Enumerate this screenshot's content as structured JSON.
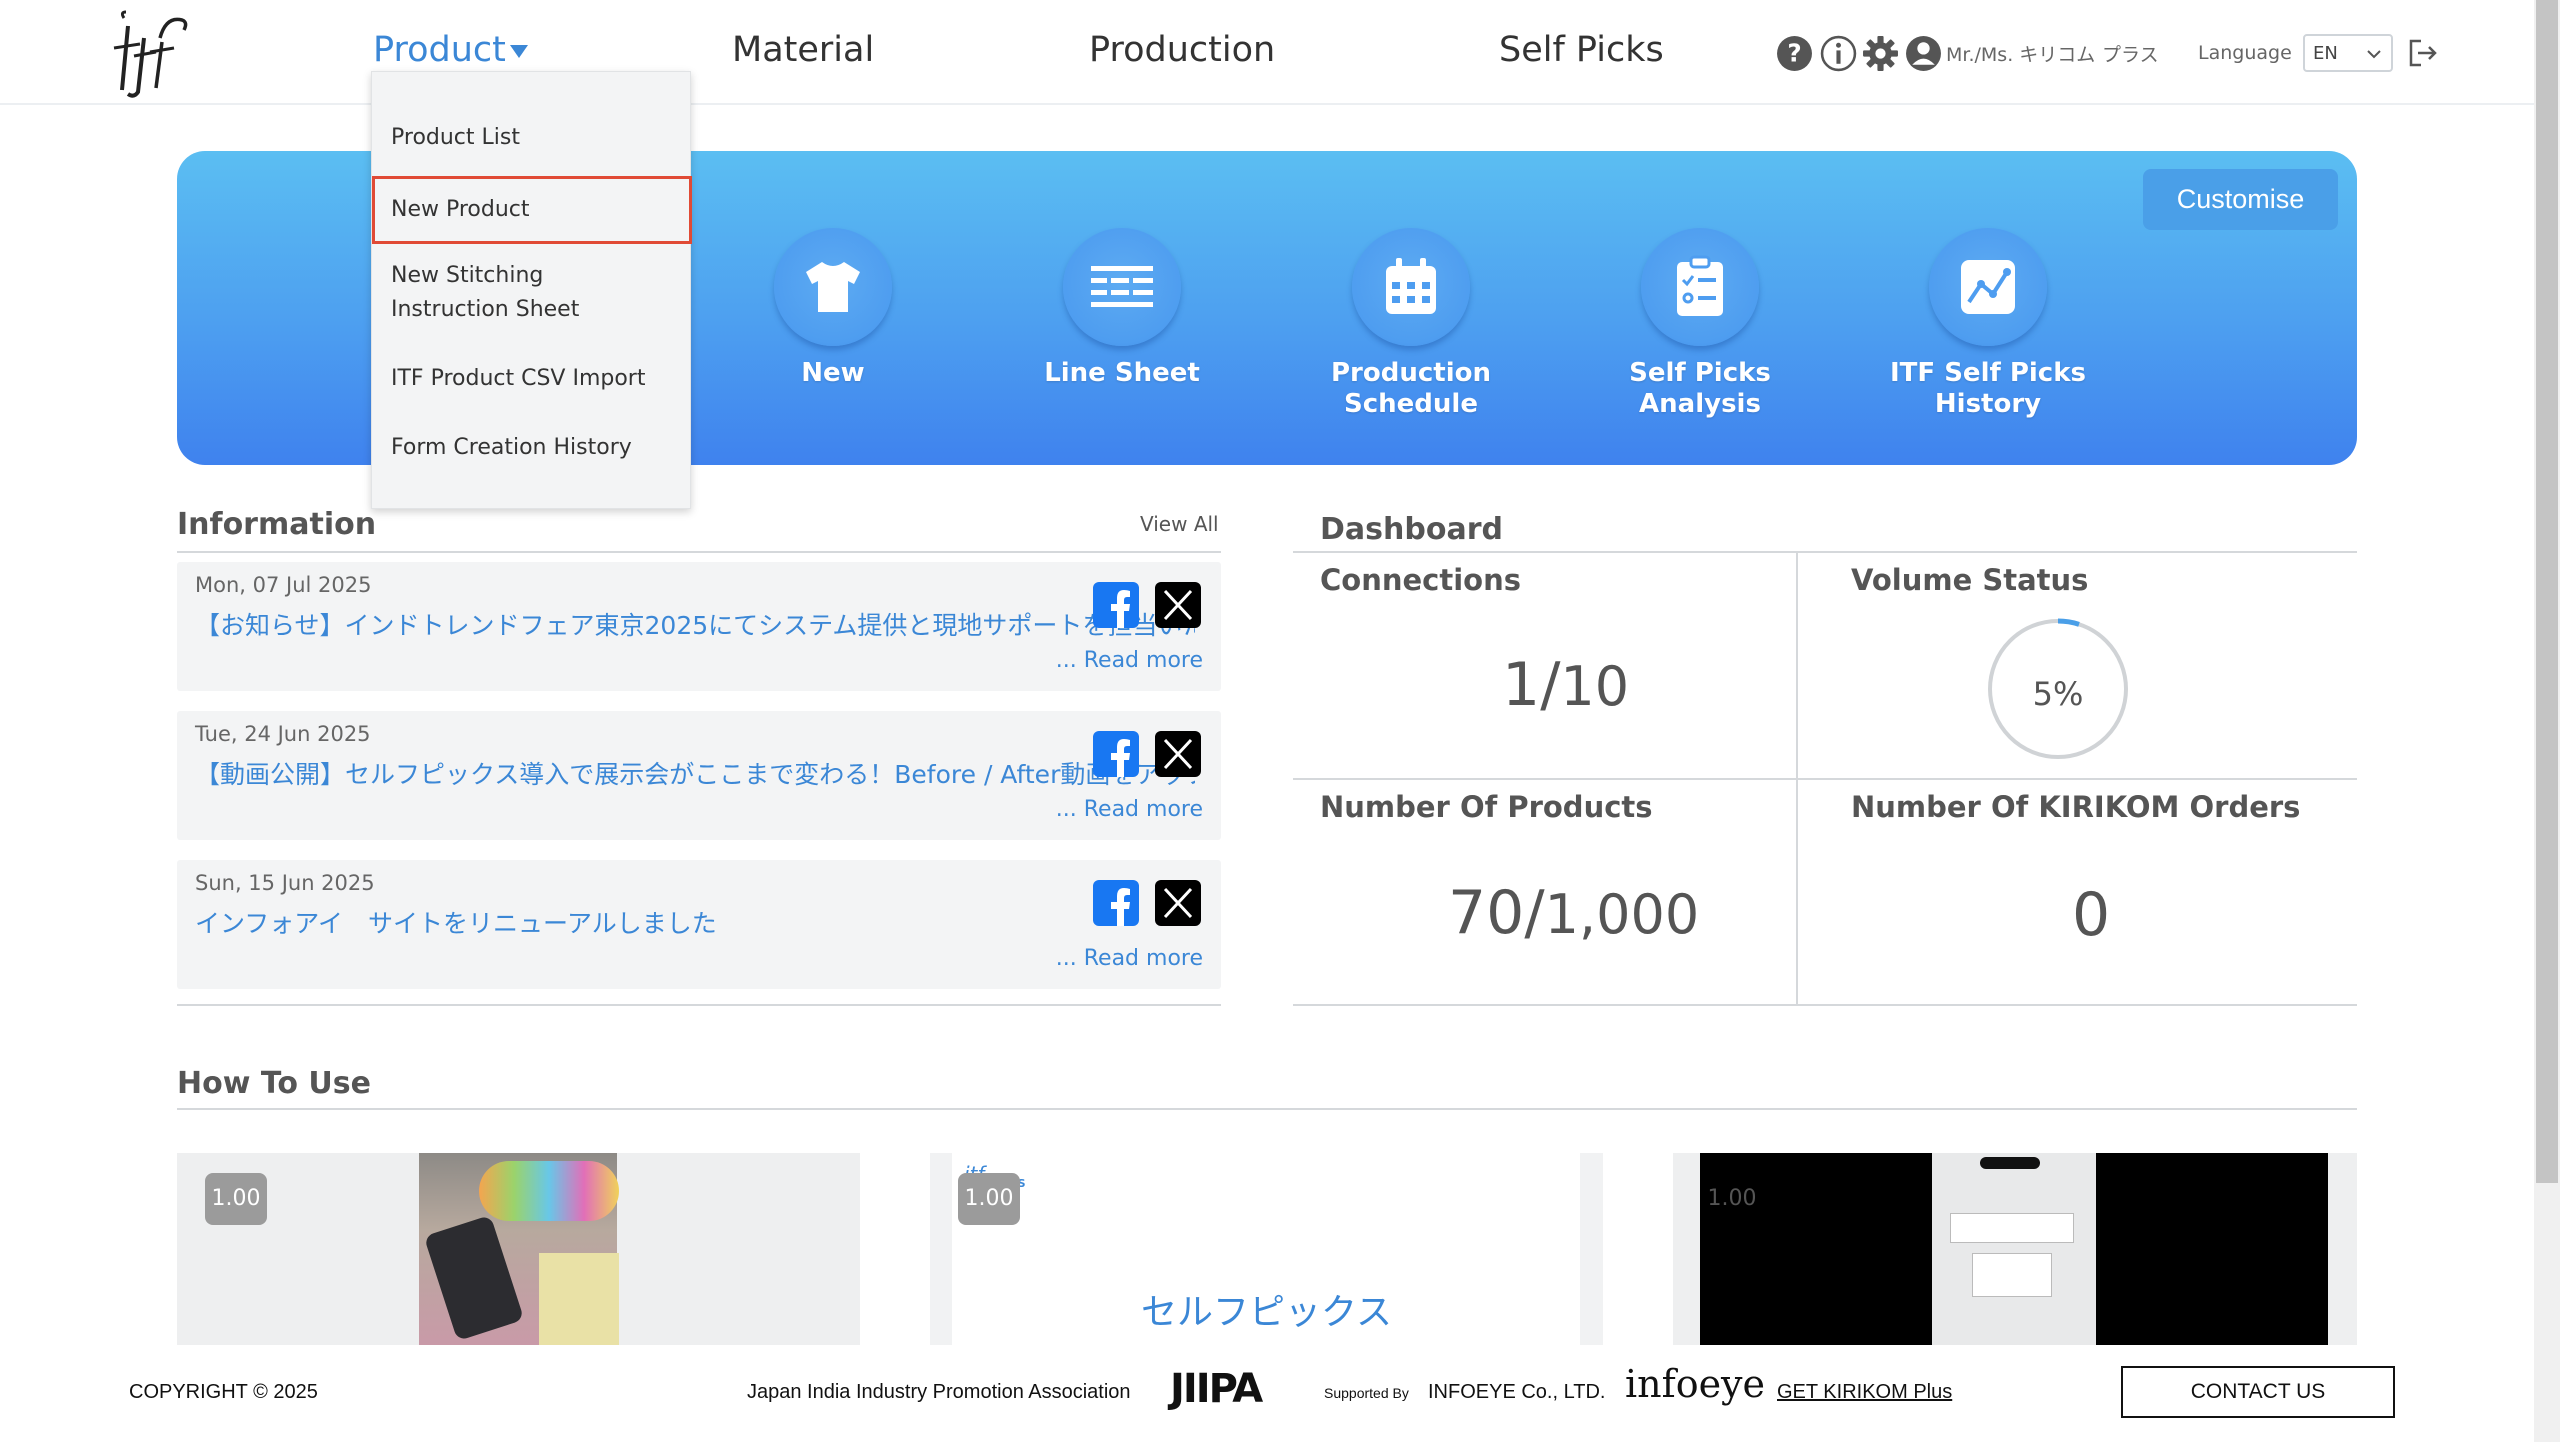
{
  "header": {
    "nav": [
      {
        "label": "Product",
        "active": true
      },
      {
        "label": "Material"
      },
      {
        "label": "Production"
      },
      {
        "label": "Self Picks"
      }
    ],
    "user_name": "Mr./Ms. キリコム",
    "user_plan": "プラス",
    "language_label": "Language",
    "language_value": "EN",
    "icons": [
      "help-icon",
      "info-icon",
      "gear-icon",
      "user-icon",
      "logout-icon"
    ]
  },
  "product_menu": {
    "items": [
      {
        "label": "Product List"
      },
      {
        "label": "New Product",
        "selected": true
      },
      {
        "label": "New Stitching Instruction Sheet"
      },
      {
        "label": "ITF Product CSV Import"
      },
      {
        "label": "Form Creation History"
      }
    ]
  },
  "banner": {
    "customise_label": "Customise",
    "shortcuts": [
      {
        "label": "New",
        "icon": "tshirt-icon"
      },
      {
        "label": "Line Sheet",
        "icon": "list-icon"
      },
      {
        "label": "Production Schedule",
        "icon": "calendar-icon"
      },
      {
        "label": "Self Picks Analysis",
        "icon": "clipboard-icon"
      },
      {
        "label": "ITF Self Picks History",
        "icon": "chart-icon"
      }
    ]
  },
  "information": {
    "title": "Information",
    "view_all": "View All",
    "read_more": "... Read more",
    "news": [
      {
        "date": "Mon, 07 Jul 2025",
        "text": "【お知らせ】インドトレンドフェア東京2025にてシステム提供と現地サポートを担当いた"
      },
      {
        "date": "Tue, 24 Jun 2025",
        "text": "【動画公開】セルフピックス導入で展示会がここまで変わる！Before / After動画をアップ"
      },
      {
        "date": "Sun, 15 Jun 2025",
        "text": "インフォアイ　サイトをリニューアルしました"
      }
    ]
  },
  "dashboard": {
    "title": "Dashboard",
    "connections": {
      "title": "Connections",
      "current": "1",
      "total": "10"
    },
    "volume": {
      "title": "Volume Status",
      "percent_label": "5%",
      "percent": 5
    },
    "products": {
      "title": "Number Of Products",
      "current": "70",
      "total": "1,000"
    },
    "orders": {
      "title": "Number Of KIRIKOM Orders",
      "value": "0"
    }
  },
  "how_to_use": {
    "title": "How To Use",
    "videos": [
      {
        "speed": "1.00"
      },
      {
        "speed": "1.00",
        "caption": "セルフピックス"
      },
      {
        "speed": "1.00"
      }
    ]
  },
  "footer": {
    "copyright": "COPYRIGHT © 2025",
    "association": "Japan India Industry Promotion Association",
    "jiipa": "JIIPA",
    "supported_by": "Supported By",
    "company": "INFOEYE Co., LTD.",
    "infoeye_logo": "infoeye",
    "kirikom_link": "GET KIRIKOM Plus",
    "contact": "CONTACT US"
  },
  "colors": {
    "accent": "#3b87d6",
    "banner_top": "#5bbef2",
    "banner_bottom": "#3f82ee",
    "highlight": "#e04a35"
  }
}
